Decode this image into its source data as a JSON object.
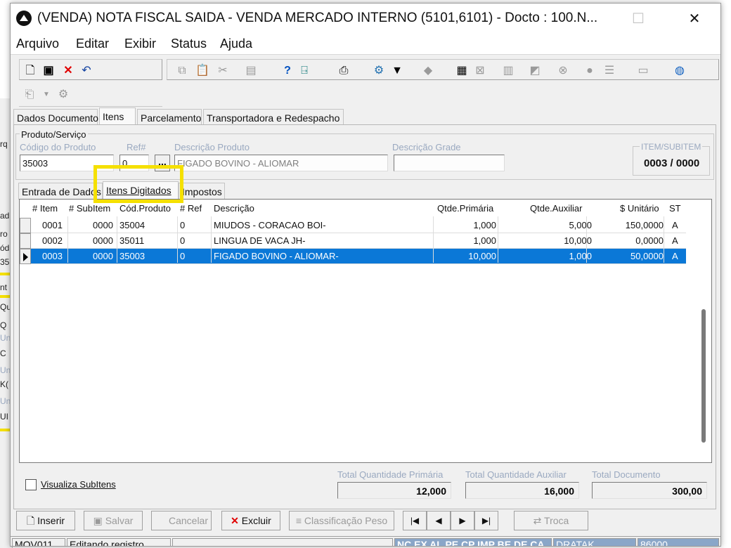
{
  "window": {
    "title": "(VENDA) NOTA FISCAL SAIDA - VENDA MERCADO INTERNO (5101,6101) - Docto : 100.N...",
    "minimize": "—",
    "maximize": "☐",
    "close": "✕"
  },
  "menu": [
    "Arquivo",
    "Editar",
    "Exibir",
    "Status",
    "Ajuda"
  ],
  "background_window": {
    "fragments": [
      "rq",
      "ad",
      "ro",
      "ód",
      "35",
      "nt",
      "Qu",
      "Q",
      "Un",
      "C",
      "Un",
      "K(",
      "Un",
      "UI"
    ]
  },
  "tabs": [
    "Dados Documento",
    "Itens",
    "Parcelamento",
    "Transportadora e Redespacho"
  ],
  "product": {
    "group_label": "Produto/Serviço",
    "code_label": "Código do Produto",
    "code_value": "35003",
    "ref_label": "Ref#",
    "ref_value": "0",
    "ellipsis": "...",
    "desc_label": "Descrição Produto",
    "desc_value": "FIGADO BOVINO - ALIOMAR",
    "grade_label": "Descrição Grade",
    "grade_value": "",
    "item_label": "ITEM/SUBITEM",
    "item_value": "0003 / 0000"
  },
  "subtabs": [
    "Entrada de Dados",
    "Itens Digitados",
    "Impostos"
  ],
  "grid": {
    "headers": [
      "# Item",
      "# SubItem",
      "Cód.Produto",
      "# Ref",
      "Descrição",
      "Qtde.Primária",
      "Qtde.Auxiliar",
      "$ Unitário",
      "ST"
    ],
    "rows": [
      {
        "item": "0001",
        "subitem": "0000",
        "cod": "35004",
        "ref": "0",
        "desc": "MIUDOS - CORACAO BOI-",
        "qp": "1,000",
        "qa": "5,000",
        "unit": "150,0000",
        "st": "A"
      },
      {
        "item": "0002",
        "subitem": "0000",
        "cod": "35011",
        "ref": "0",
        "desc": "LINGUA DE VACA JH-",
        "qp": "1,000",
        "qa": "10,000",
        "unit": "0,0000",
        "st": "A"
      },
      {
        "item": "0003",
        "subitem": "0000",
        "cod": "35003",
        "ref": "0",
        "desc": "FIGADO BOVINO - ALIOMAR-",
        "qp": "10,000",
        "qa": "1,000",
        "unit": "50,0000",
        "st": "A"
      }
    ],
    "selected_row": 2
  },
  "footer": {
    "checkbox_label": "Visualiza SubItens",
    "total_primary_label": "Total Quantidade Primária",
    "total_primary": "12,000",
    "total_aux_label": "Total Quantidade Auxiliar",
    "total_aux": "16,000",
    "total_doc_label": "Total Documento",
    "total_doc": "300,00"
  },
  "buttons": {
    "insert": "Inserir",
    "save": "Salvar",
    "cancel": "Cancelar",
    "delete": "Excluir",
    "classification": "Classificação Peso",
    "first": "|◀",
    "prev": "◀",
    "next": "▶",
    "last": "▶|",
    "swap": "Troca"
  },
  "status": {
    "code": "MOV011",
    "message": "Editando registro",
    "indicators": "NC  EX  AL  PE  CP  IMP  BE  DE  CA",
    "right1": "DRATAK",
    "right2": "86000"
  },
  "colors": {
    "selection": "#0b78d7",
    "highlight": "#f5e000",
    "disabled_label": "#9aa9c0"
  }
}
